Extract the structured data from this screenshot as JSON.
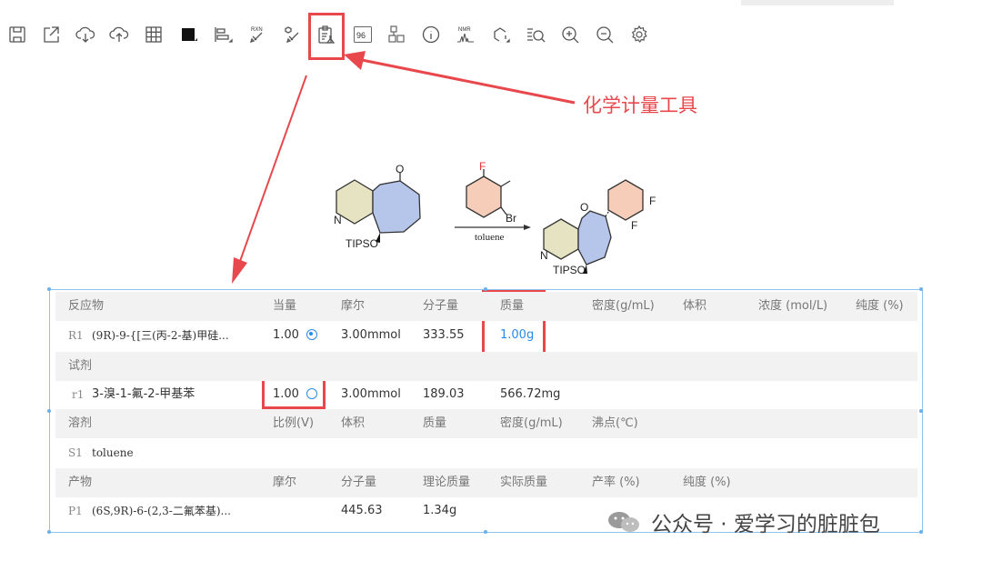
{
  "toolbar": {
    "icons": [
      "save-icon",
      "export-icon",
      "cloud-download-icon",
      "cloud-upload-icon",
      "grid-icon",
      "color-fill-icon",
      "align-icon",
      "rxn-cleanup-icon",
      "clean-structure-icon",
      "stoichiometry-icon",
      "count-icon",
      "label-icon",
      "info-icon",
      "nmr-icon",
      "fragment-icon",
      "search-icon",
      "zoom-in-icon",
      "zoom-out-icon",
      "settings-icon"
    ],
    "rxn_label": "RXN",
    "count_label": "96",
    "nmr_label": "NMR"
  },
  "callout": {
    "text": "化学计量工具",
    "color": "#e8474c"
  },
  "scheme": {
    "reactant_label": "TIPSO",
    "product_label": "TIPSO",
    "reagent_F": "F",
    "reagent_Br": "Br",
    "condition": "toluene",
    "product_F1": "F",
    "product_F2": "F",
    "ketone_O": "O",
    "N": "N"
  },
  "table": {
    "reactants_header": [
      "反应物",
      "当量",
      "摩尔",
      "分子量",
      "质量",
      "密度(g/mL)",
      "体积",
      "浓度 (mol/L)",
      "纯度 (%)"
    ],
    "reactants": [
      {
        "id": "R1",
        "name": "(9R)-9-{[三(丙-2-基)甲硅...",
        "equiv": "1.00",
        "moles": "3.00mmol",
        "mw": "333.55",
        "mass": "1.00g",
        "radio_on": true
      }
    ],
    "reagents_header": [
      "试剂"
    ],
    "reagents": [
      {
        "id": "r1",
        "name": "3-溴-1-氟-2-甲基苯",
        "equiv": "1.00",
        "moles": "3.00mmol",
        "mw": "189.03",
        "mass": "566.72mg",
        "radio_on": false
      }
    ],
    "solvents_header": [
      "溶剂",
      "比例(V)",
      "体积",
      "质量",
      "密度(g/mL)",
      "沸点(℃)"
    ],
    "solvents": [
      {
        "id": "S1",
        "name": "toluene"
      }
    ],
    "products_header": [
      "产物",
      "摩尔",
      "分子量",
      "理论质量",
      "实际质量",
      "产率 (%)",
      "纯度 (%)"
    ],
    "products": [
      {
        "id": "P1",
        "name": "(6S,9R)-6-(2,3-二氟苯基)...",
        "mw": "445.63",
        "theoretical_mass": "1.34g"
      }
    ]
  },
  "watermark": {
    "text": "公众号 · 爱学习的脏脏包"
  },
  "colors": {
    "accent_red": "#e8474c",
    "link_blue": "#2a8ae8",
    "selection_blue": "#8ec3ee"
  }
}
